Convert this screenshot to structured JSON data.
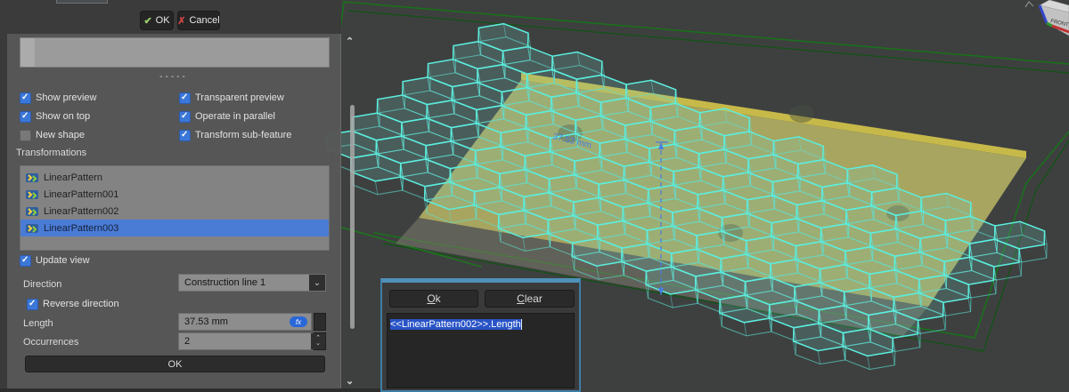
{
  "topbar": {
    "ok_label": "OK",
    "cancel_label": "Cancel"
  },
  "panel": {
    "separator": "-----",
    "options": [
      {
        "label": "Show preview",
        "checked": true
      },
      {
        "label": "Show on top",
        "checked": true
      },
      {
        "label": "New shape",
        "checked": false
      },
      {
        "label": "Transparent preview",
        "checked": true
      },
      {
        "label": "Operate in parallel",
        "checked": true
      },
      {
        "label": "Transform sub-feature",
        "checked": true
      }
    ],
    "transformations": {
      "label": "Transformations",
      "items": [
        {
          "label": "LinearPattern",
          "selected": false
        },
        {
          "label": "LinearPattern001",
          "selected": false
        },
        {
          "label": "LinearPattern002",
          "selected": false
        },
        {
          "label": "LinearPattern003",
          "selected": true
        }
      ]
    },
    "update_view": {
      "label": "Update view",
      "checked": true
    },
    "direction": {
      "label": "Direction",
      "value": "Construction line 1"
    },
    "reverse_direction": {
      "label": "Reverse direction",
      "checked": true
    },
    "length": {
      "label": "Length",
      "value": "37.53 mm",
      "fx_icon_label": "fx"
    },
    "occurrences": {
      "label": "Occurrences",
      "value": "2"
    },
    "ok_label": "OK"
  },
  "formula_editor": {
    "ok_label": "Ok",
    "clear_label": "Clear",
    "expression": "<<LinearPattern002>>.Length"
  },
  "viewport": {
    "dimension_label": "37.53 mm",
    "nav_cube_face": "FRONT"
  },
  "colors": {
    "accent_blue": "#3b77d8",
    "selection_blue": "#4a7cd6",
    "hex_wire_cyan": "#5beede",
    "body_wire_green": "#177317",
    "plate_yellow": "#b0ae62",
    "dialog_border": "#3d7ea6"
  }
}
